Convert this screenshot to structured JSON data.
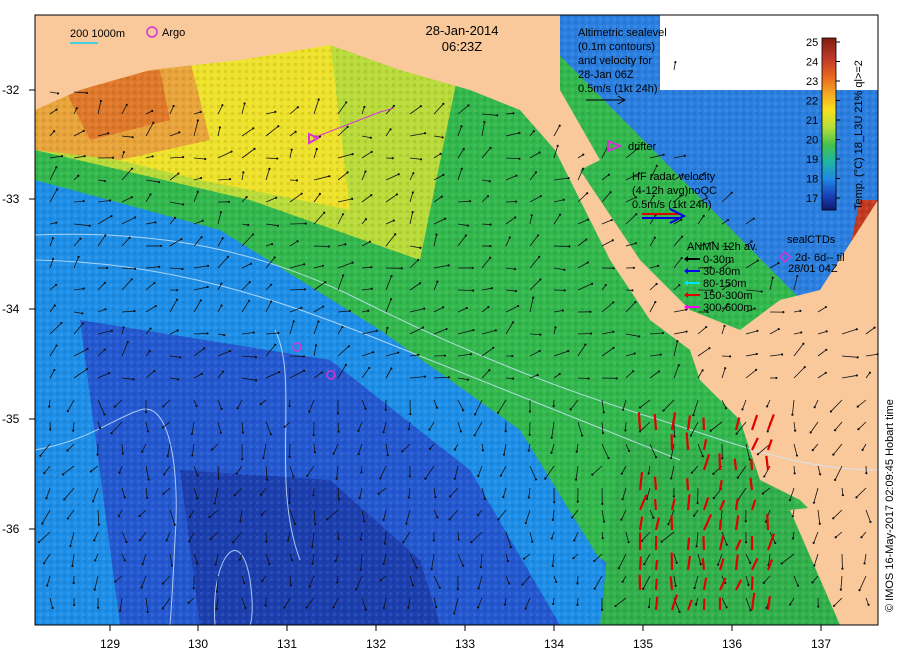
{
  "title": {
    "date": "28-Jan-2014",
    "time": "06:23Z"
  },
  "scale_legend": {
    "depths": "200  1000m",
    "argo_label": "Argo"
  },
  "altimetry": {
    "lines": [
      "Altimetric sealevel",
      "(0.1m contours)",
      "and velocity for",
      "28-Jan 06Z",
      "0.5m/s (1kt 24h)"
    ]
  },
  "drifter": {
    "label": "drifter"
  },
  "hf_radar": {
    "lines": [
      "HF radar velocity",
      "(4-12h avg)noQC",
      "0.5m/s (1kt 24h)"
    ]
  },
  "anmn": {
    "title": "ANMN 12h av.",
    "items": [
      {
        "label": "0-30m",
        "color": "#000000"
      },
      {
        "label": "30-80m",
        "color": "#0000ff"
      },
      {
        "label": "80-150m",
        "color": "#00e5ff"
      },
      {
        "label": "150-300m",
        "color": "#e00000"
      },
      {
        "label": "300-600m",
        "color": "#ff00ff"
      }
    ]
  },
  "seal": {
    "lines": [
      "sealCTDs",
      "2d- 6d-- til",
      "28/01 04Z"
    ]
  },
  "colorbar": {
    "ticks": [
      "25",
      "24",
      "23",
      "22",
      "21",
      "20",
      "19",
      "18",
      "17"
    ],
    "label": "Temp. (°C) 18_L3U 21% ql>=2",
    "colors": [
      "#7f1d10",
      "#c0392b",
      "#e8641c",
      "#f5a623",
      "#f7e11e",
      "#b5e03a",
      "#44c24a",
      "#1fb5a5",
      "#1e88e5",
      "#1a3fb8",
      "#101a6e"
    ]
  },
  "credit": "© IMOS 16-May-2017 02:09:45 Hobart time",
  "axes": {
    "x_ticks": [
      "129",
      "130",
      "131",
      "132",
      "133",
      "134",
      "135",
      "136",
      "137"
    ],
    "y_ticks": [
      "-32",
      "-33",
      "-34",
      "-35",
      "-36"
    ]
  },
  "palette": {
    "land": "#f9c89b",
    "deep": "#1d3fb8",
    "mid": "#2196f3",
    "shelf": "#3dbb4a",
    "warm": "#e9e23a",
    "hot": "#e07a2a"
  }
}
